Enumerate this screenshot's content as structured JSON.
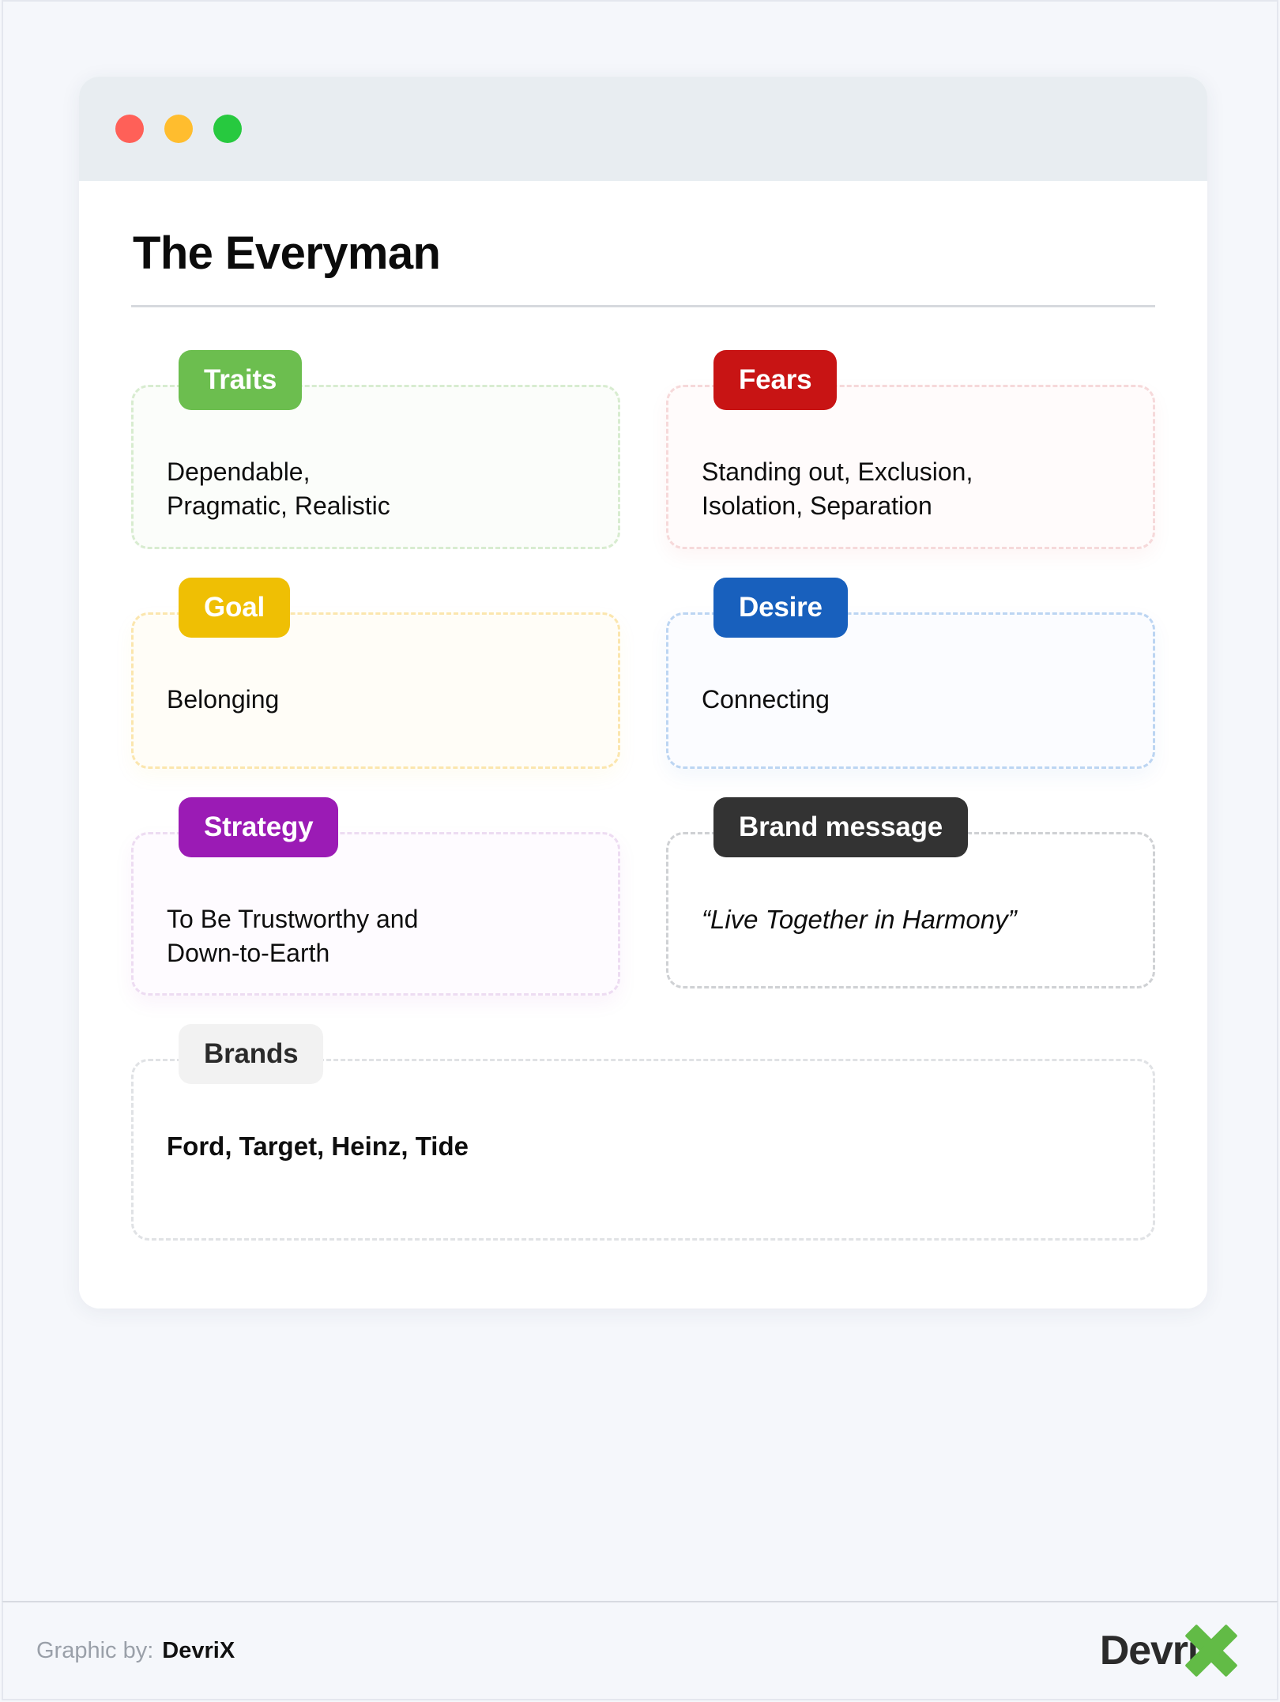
{
  "window": {
    "dots": [
      "traffic-light-red",
      "traffic-light-yellow",
      "traffic-light-green"
    ]
  },
  "header": {
    "title": "The Everyman"
  },
  "blocks": [
    {
      "key": "traits",
      "badge": "Traits",
      "text": "Dependable,\nPragmatic, Realistic",
      "color": "#6cbe4f"
    },
    {
      "key": "fears",
      "badge": "Fears",
      "text": "Standing out, Exclusion,\nIsolation, Separation",
      "color": "#c81414"
    },
    {
      "key": "goal",
      "badge": "Goal",
      "text": "Belonging",
      "color": "#efbf04"
    },
    {
      "key": "desire",
      "badge": "Desire",
      "text": "Connecting",
      "color": "#1860bd"
    },
    {
      "key": "strategy",
      "badge": "Strategy",
      "text": "To Be Trustworthy and\nDown-to-Earth",
      "color": "#9b1bb5"
    },
    {
      "key": "brand-message",
      "badge": "Brand message",
      "text": "“Live Together in Harmony”",
      "color": "#333333"
    },
    {
      "key": "brands",
      "badge": "Brands",
      "text": "Ford, Target, Heinz, Tide",
      "color": "#f2f2f2"
    }
  ],
  "footer": {
    "credit_label": "Graphic by:",
    "credit_brand": "DevriX",
    "logo_word": "Devri",
    "logo_mark": "x-mark",
    "logo_accent": "#62bb46"
  }
}
